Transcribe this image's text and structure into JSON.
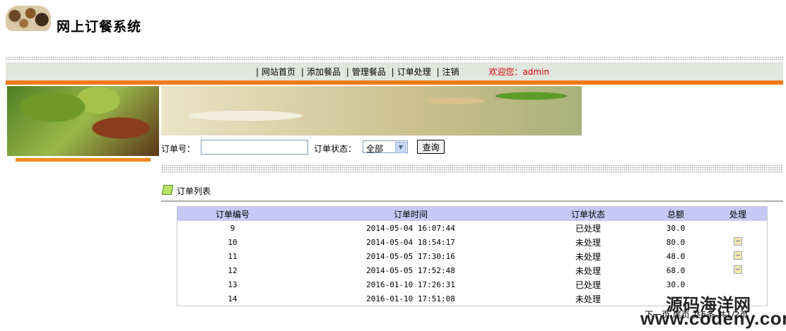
{
  "header": {
    "title": "网上订餐系统"
  },
  "nav": {
    "items": [
      {
        "label": "网站首页"
      },
      {
        "label": "添加餐品"
      },
      {
        "label": "管理餐品"
      },
      {
        "label": "订单处理"
      },
      {
        "label": "注销"
      }
    ],
    "welcome": "欢迎您：admin"
  },
  "search": {
    "order_no_label": "订单号：",
    "order_no_value": "",
    "status_label": "订单状态：",
    "status_selected": "全部",
    "query_button": "查询"
  },
  "list": {
    "title": "订单列表",
    "columns": [
      "订单编号",
      "订单时间",
      "订单状态",
      "总额",
      "处理"
    ],
    "rows": [
      {
        "id": "9",
        "time": "2014-05-04 16:07:44",
        "status": "已处理",
        "total": "30.0"
      },
      {
        "id": "10",
        "time": "2014-05-04 18:54:17",
        "status": "未处理",
        "total": "80.0"
      },
      {
        "id": "11",
        "time": "2014-05-05 17:30:16",
        "status": "未处理",
        "total": "48.0"
      },
      {
        "id": "12",
        "time": "2014-05-05 17:52:48",
        "status": "未处理",
        "total": "68.0"
      },
      {
        "id": "13",
        "time": "2016-01-10 17:26:31",
        "status": "已处理",
        "total": "30.0"
      },
      {
        "id": "14",
        "time": "2016-01-10 17:51:08",
        "status": "未处理",
        "total": ""
      }
    ]
  },
  "pager": {
    "text": "下一页 尾页 共6条 共1/2页"
  },
  "watermark": {
    "cn": "源码海洋网",
    "url": "www.codeny.com"
  },
  "colors": {
    "nav_bg": "#e1e6de",
    "accent_orange": "#ef7a1a",
    "table_header": "#c7c8f5",
    "welcome_red": "#d40000"
  }
}
